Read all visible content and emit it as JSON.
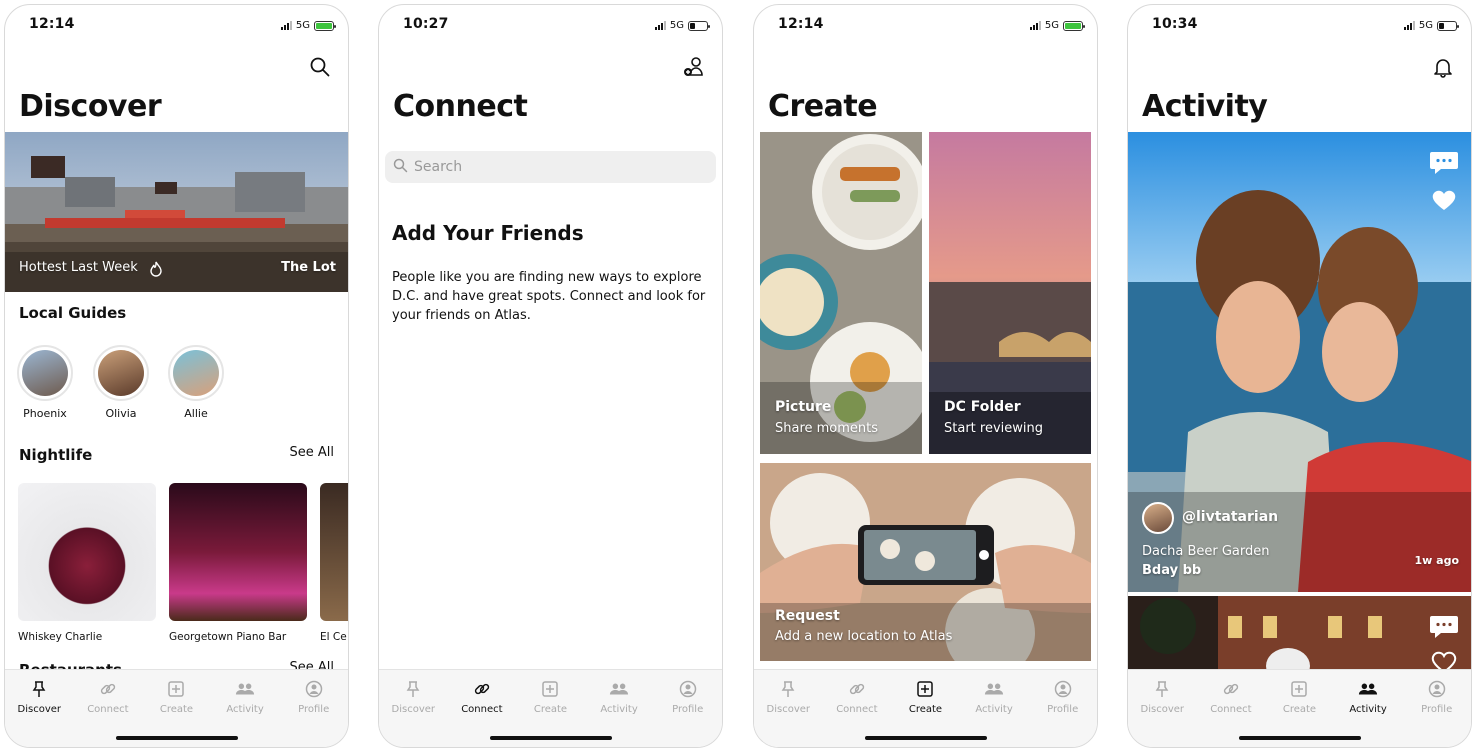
{
  "screens": [
    {
      "time": "12:14",
      "network": "5G",
      "title": "Discover",
      "hero": {
        "left": "Hottest Last Week",
        "right": "The Lot"
      },
      "local_guides": {
        "heading": "Local Guides",
        "guides": [
          {
            "name": "Phoenix"
          },
          {
            "name": "Olivia"
          },
          {
            "name": "Allie"
          }
        ]
      },
      "nightlife": {
        "heading": "Nightlife",
        "see_all": "See All",
        "cards": [
          {
            "label": "Whiskey Charlie"
          },
          {
            "label": "Georgetown Piano Bar"
          },
          {
            "label": "El Ce"
          }
        ]
      },
      "restaurants": {
        "heading": "Restaurants",
        "see_all": "See All"
      }
    },
    {
      "time": "10:27",
      "network": "5G",
      "title": "Connect",
      "search_placeholder": "Search",
      "add_heading": "Add Your Friends",
      "add_body": "People like you are finding new ways to explore D.C. and have great spots. Connect and look for your friends on Atlas."
    },
    {
      "time": "12:14",
      "network": "5G",
      "title": "Create",
      "tiles": [
        {
          "title": "Picture",
          "subtitle": "Share moments"
        },
        {
          "title": "DC Folder",
          "subtitle": "Start reviewing"
        },
        {
          "title": "Request",
          "subtitle": "Add a new location to Atlas"
        }
      ]
    },
    {
      "time": "10:34",
      "network": "5G",
      "title": "Activity",
      "post": {
        "user": "@livtatarian",
        "place": "Dacha Beer Garden",
        "caption": "Bday bb",
        "ago": "1w ago"
      }
    }
  ],
  "tabs": [
    {
      "label": "Discover"
    },
    {
      "label": "Connect"
    },
    {
      "label": "Create"
    },
    {
      "label": "Activity"
    },
    {
      "label": "Profile"
    }
  ],
  "colors": {
    "battery_charging": "#3ec43e",
    "inactive_tab": "#aaaaaa",
    "active_tab": "#111111"
  }
}
